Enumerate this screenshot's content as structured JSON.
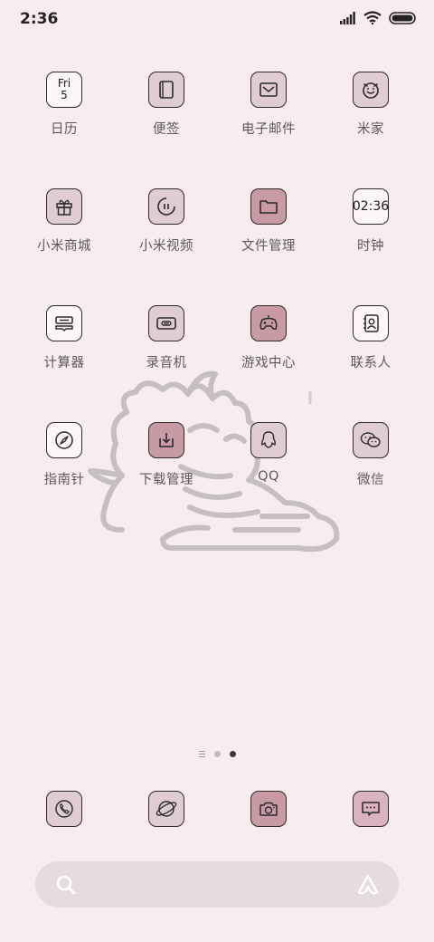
{
  "status_bar": {
    "time": "2:36",
    "icons": [
      "signal-icon",
      "wifi-icon",
      "battery-icon"
    ]
  },
  "apps": [
    {
      "label": "日历",
      "icon": "calendar-icon",
      "day": "Fri",
      "date": "5"
    },
    {
      "label": "便签",
      "icon": "notes-icon"
    },
    {
      "label": "电子邮件",
      "icon": "mail-icon"
    },
    {
      "label": "米家",
      "icon": "mijia-icon"
    },
    {
      "label": "小米商城",
      "icon": "gift-icon"
    },
    {
      "label": "小米视频",
      "icon": "video-icon"
    },
    {
      "label": "文件管理",
      "icon": "folder-icon"
    },
    {
      "label": "时钟",
      "icon": "clock-icon",
      "time": "02:36"
    },
    {
      "label": "计算器",
      "icon": "calculator-icon"
    },
    {
      "label": "录音机",
      "icon": "recorder-icon"
    },
    {
      "label": "游戏中心",
      "icon": "gamepad-icon"
    },
    {
      "label": "联系人",
      "icon": "contacts-icon"
    },
    {
      "label": "指南针",
      "icon": "compass-icon"
    },
    {
      "label": "下载管理",
      "icon": "download-icon"
    },
    {
      "label": "QQ",
      "icon": "qq-icon"
    },
    {
      "label": "微信",
      "icon": "wechat-icon"
    }
  ],
  "page_indicator": {
    "pages": 2,
    "active": 2
  },
  "dock": [
    {
      "icon": "phone-icon"
    },
    {
      "icon": "browser-icon"
    },
    {
      "icon": "camera-icon"
    },
    {
      "icon": "messages-icon"
    }
  ],
  "search_bar": {
    "left_icon": "search-icon",
    "right_icon": "assistant-icon"
  },
  "colors": {
    "background": "#f9ecee",
    "tile_light": "#e0cdd2",
    "tile_mid": "#c79aa6",
    "tile_white": "#fcf6f7"
  }
}
